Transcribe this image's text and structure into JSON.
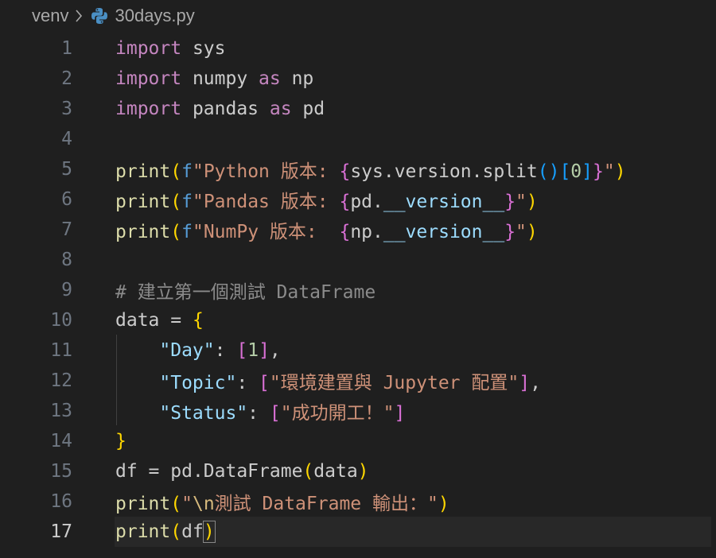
{
  "breadcrumb": {
    "folder": "venv",
    "file": "30days.py"
  },
  "editor": {
    "current_line": 17,
    "lines": [
      {
        "n": "1",
        "tokens": [
          {
            "t": "import",
            "c": "kw"
          },
          {
            "t": " sys",
            "c": "plain"
          }
        ]
      },
      {
        "n": "2",
        "tokens": [
          {
            "t": "import",
            "c": "kw"
          },
          {
            "t": " numpy ",
            "c": "plain"
          },
          {
            "t": "as",
            "c": "kw"
          },
          {
            "t": " np",
            "c": "plain"
          }
        ]
      },
      {
        "n": "3",
        "tokens": [
          {
            "t": "import",
            "c": "kw"
          },
          {
            "t": " pandas ",
            "c": "plain"
          },
          {
            "t": "as",
            "c": "kw"
          },
          {
            "t": " pd",
            "c": "plain"
          }
        ]
      },
      {
        "n": "4",
        "tokens": []
      },
      {
        "n": "5",
        "tokens": [
          {
            "t": "print",
            "c": "fn"
          },
          {
            "t": "(",
            "c": "b1"
          },
          {
            "t": "f",
            "c": "fpre"
          },
          {
            "t": "\"Python 版本: ",
            "c": "str"
          },
          {
            "t": "{",
            "c": "b2"
          },
          {
            "t": "sys.version.split",
            "c": "plain"
          },
          {
            "t": "(",
            "c": "b3"
          },
          {
            "t": ")",
            "c": "b3"
          },
          {
            "t": "[",
            "c": "b3"
          },
          {
            "t": "0",
            "c": "num"
          },
          {
            "t": "]",
            "c": "b3"
          },
          {
            "t": "}",
            "c": "b2"
          },
          {
            "t": "\"",
            "c": "str"
          },
          {
            "t": ")",
            "c": "b1"
          }
        ]
      },
      {
        "n": "6",
        "tokens": [
          {
            "t": "print",
            "c": "fn"
          },
          {
            "t": "(",
            "c": "b1"
          },
          {
            "t": "f",
            "c": "fpre"
          },
          {
            "t": "\"Pandas 版本: ",
            "c": "str"
          },
          {
            "t": "{",
            "c": "b2"
          },
          {
            "t": "pd.",
            "c": "plain"
          },
          {
            "t": "__version__",
            "c": "var"
          },
          {
            "t": "}",
            "c": "b2"
          },
          {
            "t": "\"",
            "c": "str"
          },
          {
            "t": ")",
            "c": "b1"
          }
        ]
      },
      {
        "n": "7",
        "tokens": [
          {
            "t": "print",
            "c": "fn"
          },
          {
            "t": "(",
            "c": "b1"
          },
          {
            "t": "f",
            "c": "fpre"
          },
          {
            "t": "\"NumPy 版本:  ",
            "c": "str"
          },
          {
            "t": "{",
            "c": "b2"
          },
          {
            "t": "np.",
            "c": "plain"
          },
          {
            "t": "__version__",
            "c": "var"
          },
          {
            "t": "}",
            "c": "b2"
          },
          {
            "t": "\"",
            "c": "str"
          },
          {
            "t": ")",
            "c": "b1"
          }
        ]
      },
      {
        "n": "8",
        "tokens": []
      },
      {
        "n": "9",
        "tokens": [
          {
            "t": "# 建立第一個測試 DataFrame",
            "c": "cm"
          }
        ]
      },
      {
        "n": "10",
        "tokens": [
          {
            "t": "data",
            "c": "plain"
          },
          {
            "t": " = ",
            "c": "plain"
          },
          {
            "t": "{",
            "c": "b1"
          }
        ]
      },
      {
        "n": "11",
        "tokens": [
          {
            "t": "    ",
            "c": "plain"
          },
          {
            "t": "\"Day\"",
            "c": "var"
          },
          {
            "t": ": ",
            "c": "plain"
          },
          {
            "t": "[",
            "c": "b2"
          },
          {
            "t": "1",
            "c": "num"
          },
          {
            "t": "]",
            "c": "b2"
          },
          {
            "t": ",",
            "c": "plain"
          }
        ]
      },
      {
        "n": "12",
        "tokens": [
          {
            "t": "    ",
            "c": "plain"
          },
          {
            "t": "\"Topic\"",
            "c": "var"
          },
          {
            "t": ": ",
            "c": "plain"
          },
          {
            "t": "[",
            "c": "b2"
          },
          {
            "t": "\"環境建置與 Jupyter 配置\"",
            "c": "str"
          },
          {
            "t": "]",
            "c": "b2"
          },
          {
            "t": ",",
            "c": "plain"
          }
        ]
      },
      {
        "n": "13",
        "tokens": [
          {
            "t": "    ",
            "c": "plain"
          },
          {
            "t": "\"Status\"",
            "c": "var"
          },
          {
            "t": ": ",
            "c": "plain"
          },
          {
            "t": "[",
            "c": "b2"
          },
          {
            "t": "\"成功開工！\"",
            "c": "str"
          },
          {
            "t": "]",
            "c": "b2"
          }
        ]
      },
      {
        "n": "14",
        "tokens": [
          {
            "t": "}",
            "c": "b1"
          }
        ]
      },
      {
        "n": "15",
        "tokens": [
          {
            "t": "df",
            "c": "plain"
          },
          {
            "t": " = ",
            "c": "plain"
          },
          {
            "t": "pd.DataFrame",
            "c": "plain"
          },
          {
            "t": "(",
            "c": "b1"
          },
          {
            "t": "data",
            "c": "plain"
          },
          {
            "t": ")",
            "c": "b1"
          }
        ]
      },
      {
        "n": "16",
        "tokens": [
          {
            "t": "print",
            "c": "fn"
          },
          {
            "t": "(",
            "c": "b1"
          },
          {
            "t": "\"",
            "c": "str"
          },
          {
            "t": "\\n",
            "c": "esc"
          },
          {
            "t": "測試 DataFrame 輸出：\"",
            "c": "str"
          },
          {
            "t": ")",
            "c": "b1"
          }
        ]
      },
      {
        "n": "17",
        "tokens": [
          {
            "t": "print",
            "c": "fn"
          },
          {
            "t": "(",
            "c": "b1"
          },
          {
            "t": "df",
            "c": "plain"
          },
          {
            "t": ")",
            "c": "b1 cursor-box"
          }
        ]
      }
    ]
  }
}
